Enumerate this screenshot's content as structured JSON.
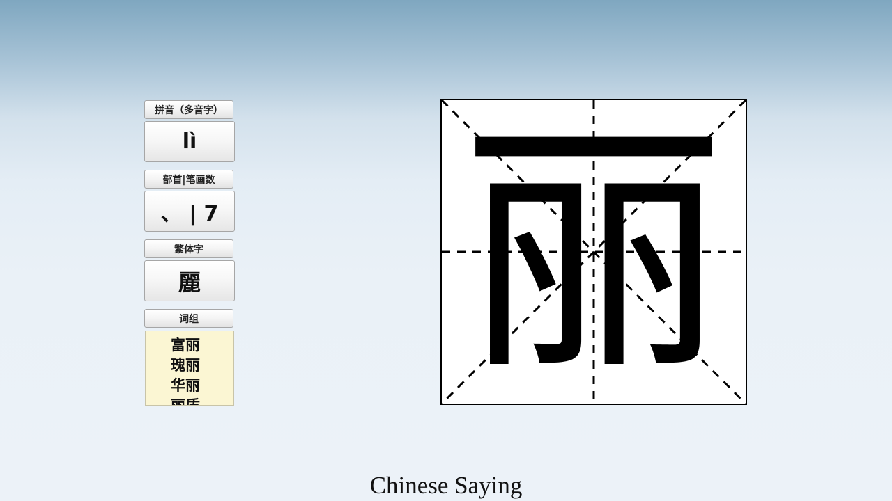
{
  "pinyin": {
    "label": "拼音（多音字）",
    "value": "lì"
  },
  "radical": {
    "label": "部首|笔画数",
    "value": "、 | 7"
  },
  "traditional": {
    "label": "繁体字",
    "value": "麗"
  },
  "words": {
    "label": "词组",
    "items": [
      "富丽",
      "瑰丽",
      "华丽",
      "丽质"
    ]
  },
  "character": {
    "glyph": "丽"
  },
  "caption": "Chinese Saying"
}
